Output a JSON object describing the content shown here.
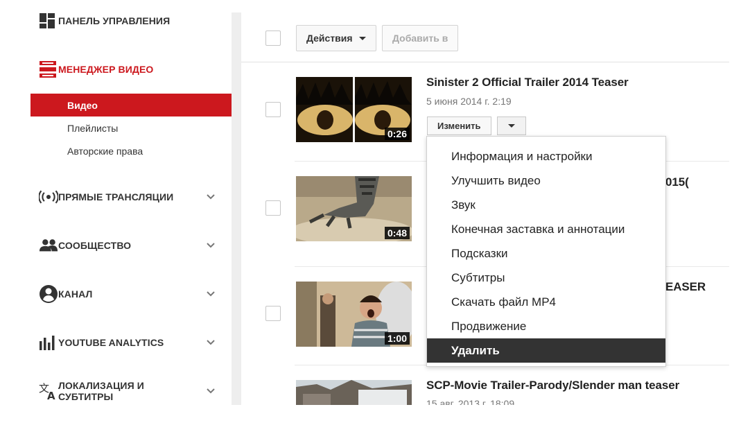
{
  "sidebar": {
    "dashboard_label": "ПАНЕЛЬ УПРАВЛЕНИЯ",
    "video_manager_label": "МЕНЕДЖЕР ВИДЕО",
    "sub_items": [
      {
        "label": "Видео",
        "selected": true
      },
      {
        "label": "Плейлисты",
        "selected": false
      },
      {
        "label": "Авторские права",
        "selected": false
      }
    ],
    "live_label": "ПРЯМЫЕ ТРАНСЛЯЦИИ",
    "community_label": "СООБЩЕСТВО",
    "channel_label": "КАНАЛ",
    "analytics_label": "YOUTUBE ANALYTICS",
    "localization_label": "ЛОКАЛИЗАЦИЯ И СУБТИТРЫ",
    "localization_line1": "ЛОКАЛИЗАЦИЯ И",
    "localization_line2": "СУБТИТРЫ"
  },
  "toolbar": {
    "actions_label": "Действия",
    "add_to_label": "Добавить в"
  },
  "videos": [
    {
      "title": "Sinister 2 Official Trailer 2014 Teaser",
      "date": "5 июня 2014 г. 2:19",
      "duration": "0:26"
    },
    {
      "title_fragment": "015(",
      "duration": "0:48"
    },
    {
      "title_fragment": "EASER",
      "duration": "1:00"
    },
    {
      "title": "SCP-Movie Trailer-Parody/Slender man teaser",
      "date": "15 авг. 2013 г. 18:09"
    }
  ],
  "edit_button_label": "Изменить",
  "menu": {
    "items": [
      "Информация и настройки",
      "Улучшить видео",
      "Звук",
      "Конечная заставка и аннотации",
      "Подсказки",
      "Субтитры",
      "Скачать файл MP4",
      "Продвижение",
      "Удалить"
    ],
    "highlighted": "Удалить"
  },
  "colors": {
    "accent_red": "#cc181e",
    "menu_highlight": "#333333"
  },
  "icons": {
    "dashboard": "dashboard-icon",
    "video_manager": "video-manager-icon",
    "live": "live-broadcast-icon",
    "community": "community-icon",
    "channel": "channel-icon",
    "analytics": "analytics-icon",
    "localization": "translate-icon"
  }
}
